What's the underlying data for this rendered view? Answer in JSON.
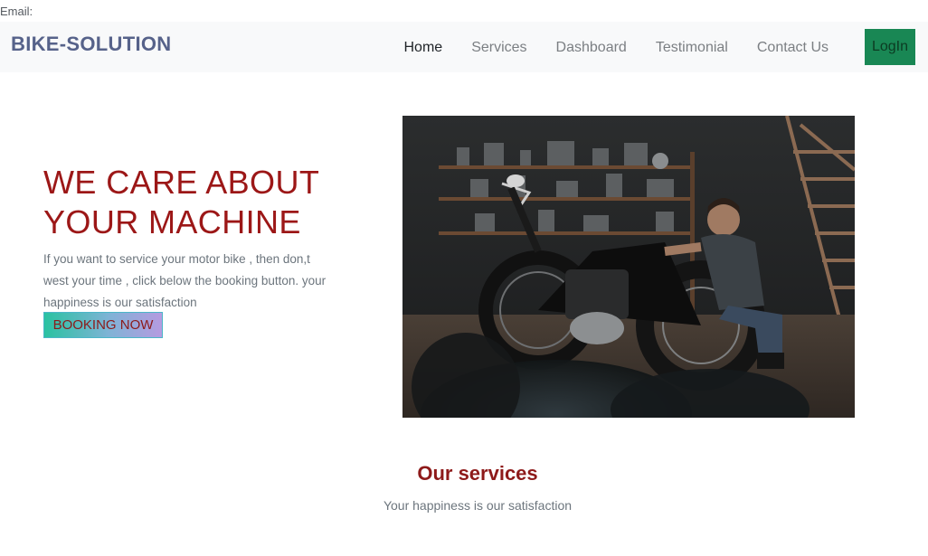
{
  "top": {
    "email_label": "Email:"
  },
  "navbar": {
    "brand": "BIKE-SOLUTION",
    "links": [
      "Home",
      "Services",
      "Dashboard",
      "Testimonial",
      "Contact Us"
    ],
    "login_label": "LogIn"
  },
  "hero": {
    "title": "WE CARE ABOUT YOUR MACHINE",
    "text": "If you want to service your motor bike , then don,t west your time , click below the booking button. your happiness is our satisfaction",
    "booking_label": "BOOKING NOW",
    "image_icon": "mechanic-motorbike-photo"
  },
  "services": {
    "title": "Our services",
    "subtitle": "Your happiness is our satisfaction"
  },
  "colors": {
    "brand": "#56628a",
    "accent_red": "#9c1717",
    "login_green": "#198754",
    "navbar_bg": "#f8f9fa"
  }
}
